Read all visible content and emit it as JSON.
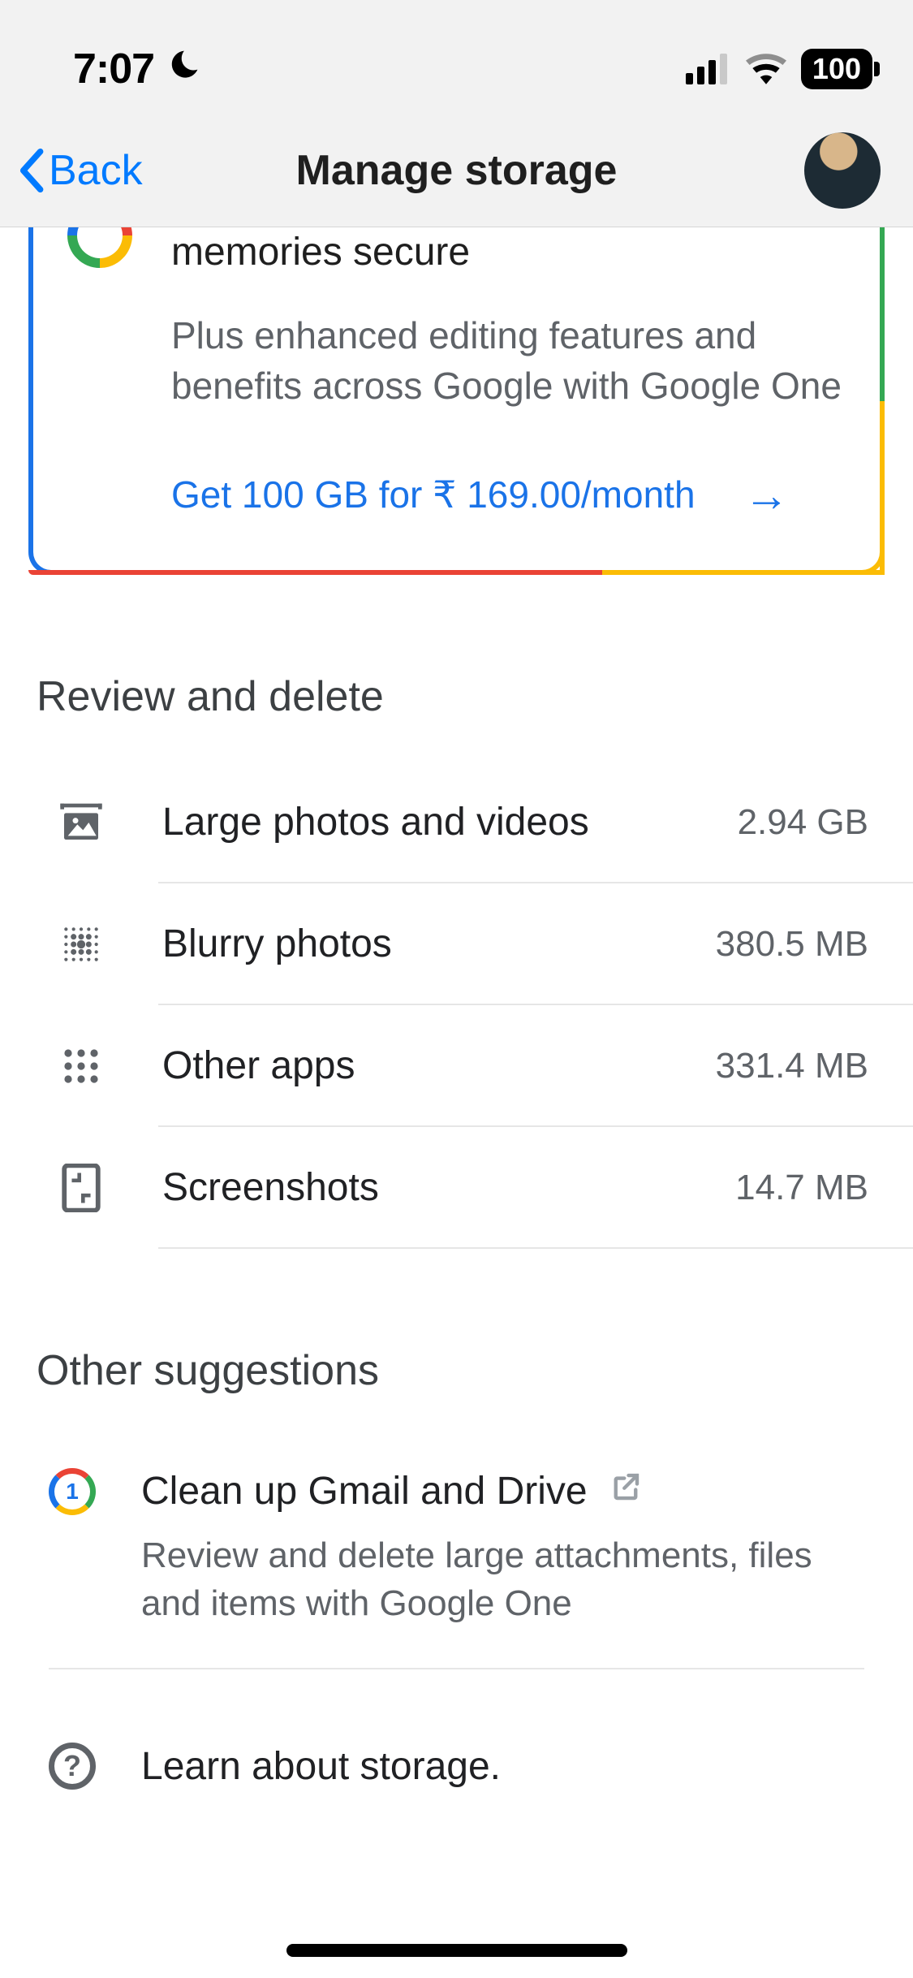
{
  "status": {
    "time": "7:07",
    "battery": "100"
  },
  "nav": {
    "back": "Back",
    "title": "Manage storage"
  },
  "promo": {
    "title_fragment": "memories secure",
    "subtitle": "Plus enhanced editing features and benefits across Google with Google One",
    "cta": "Get 100 GB for ₹ 169.00/month"
  },
  "sections": {
    "review_title": "Review and delete",
    "items": [
      {
        "label": "Large photos and videos",
        "value": "2.94 GB"
      },
      {
        "label": "Blurry photos",
        "value": "380.5 MB"
      },
      {
        "label": "Other apps",
        "value": "331.4 MB"
      },
      {
        "label": "Screenshots",
        "value": "14.7 MB"
      }
    ],
    "other_title": "Other suggestions",
    "cleanup": {
      "title": "Clean up Gmail and Drive",
      "subtitle": "Review and delete large attachments, files and items with Google One"
    },
    "learn": "Learn about storage."
  }
}
